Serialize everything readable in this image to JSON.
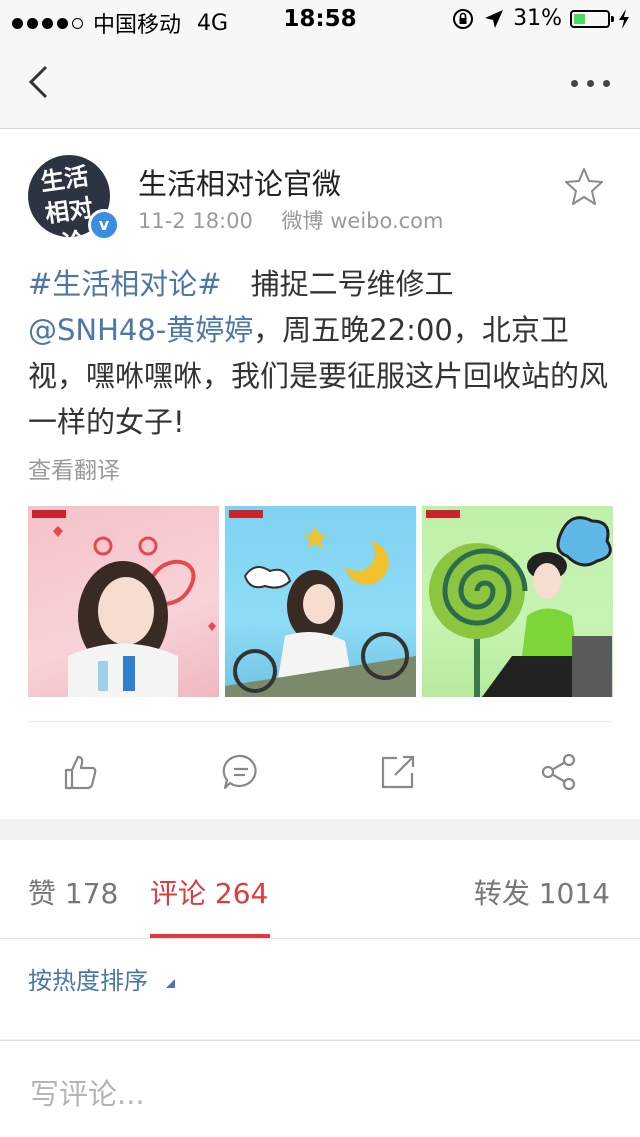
{
  "status_bar": {
    "carrier": "中国移动",
    "network": "4G",
    "time": "18:58",
    "battery": "31%",
    "battery_level": 0.31
  },
  "nav": {
    "back_icon": "chevron-left-icon",
    "more_icon": "more-dots-icon"
  },
  "post": {
    "author": "生活相对论官微",
    "avatar_text": "生活相对论",
    "verified_badge": "v",
    "date": "11-2 18:00",
    "source": "微博 weibo.com",
    "hashtag": "#生活相对论#",
    "text_1": "　捕捉二号维修工",
    "mention": "@SNH48-黄婷婷",
    "text_2": "，周五晚22:00，北京卫视，嘿咻嘿咻，我们是要征服这片回收站的风一样的女子!",
    "translate": "查看翻译",
    "images": [
      "photo-1",
      "photo-2",
      "photo-3"
    ],
    "actions": [
      "like-icon",
      "comment-icon",
      "repost-icon",
      "share-icon"
    ]
  },
  "tabs": {
    "likes": "赞 178",
    "comments": "评论 264",
    "reposts": "转发 1014"
  },
  "sort": {
    "label": "按热度排序"
  },
  "comment_box": {
    "placeholder": "写评论..."
  },
  "colors": {
    "link": "#4d77a8",
    "accent": "#e0393e"
  }
}
